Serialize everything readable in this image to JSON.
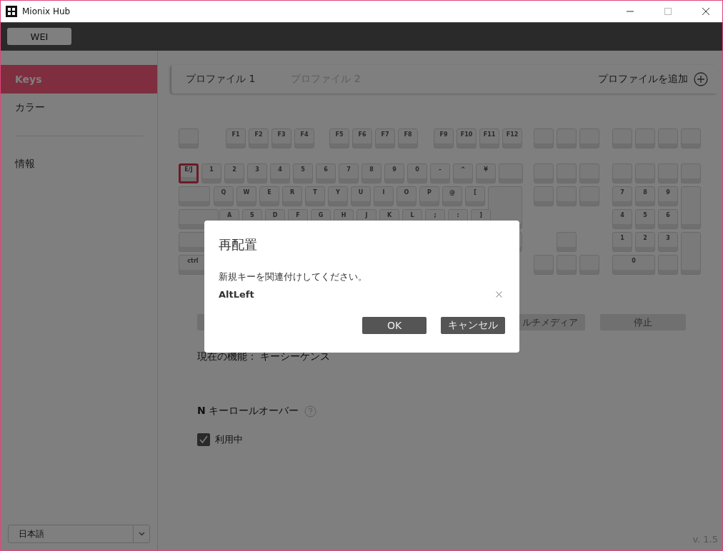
{
  "window": {
    "title": "Mionix Hub"
  },
  "device_tab": {
    "label": "WEI"
  },
  "sidebar": {
    "items": [
      {
        "label": "Keys",
        "selected": true
      },
      {
        "label": "カラー",
        "selected": false
      },
      {
        "label": "情報",
        "selected": false
      }
    ],
    "language": "日本語"
  },
  "profiles": [
    {
      "label": "プロファイル 1",
      "selected": true
    },
    {
      "label": "プロファイル 2",
      "selected": false
    }
  ],
  "add_profile": "プロファイルを追加",
  "keyboard": {
    "keys": [
      {
        "label": "F1",
        "selected": false
      },
      {
        "label": "F2",
        "selected": false
      },
      {
        "label": "F3",
        "selected": false
      },
      {
        "label": "F4",
        "selected": false
      },
      {
        "label": "F5",
        "selected": false
      },
      {
        "label": "F6",
        "selected": false
      },
      {
        "label": "F7",
        "selected": false
      },
      {
        "label": "F8",
        "selected": false
      },
      {
        "label": "F9",
        "selected": false
      },
      {
        "label": "F10",
        "selected": false
      },
      {
        "label": "F11",
        "selected": false
      },
      {
        "label": "F12",
        "selected": false
      },
      {
        "label": "E/J",
        "selected": true
      },
      {
        "label": "1",
        "selected": false
      },
      {
        "label": "2",
        "selected": false
      },
      {
        "label": "3",
        "selected": false
      },
      {
        "label": "4",
        "selected": false
      },
      {
        "label": "5",
        "selected": false
      },
      {
        "label": "6",
        "selected": false
      },
      {
        "label": "7",
        "selected": false
      },
      {
        "label": "8",
        "selected": false
      },
      {
        "label": "9",
        "selected": false
      },
      {
        "label": "0",
        "selected": false
      },
      {
        "label": "-",
        "selected": false
      },
      {
        "label": "^",
        "selected": false
      },
      {
        "label": "¥",
        "selected": false
      },
      {
        "label": "Q",
        "selected": false
      },
      {
        "label": "W",
        "selected": false
      },
      {
        "label": "E",
        "selected": false
      },
      {
        "label": "R",
        "selected": false
      },
      {
        "label": "T",
        "selected": false
      },
      {
        "label": "Y",
        "selected": false
      },
      {
        "label": "U",
        "selected": false
      },
      {
        "label": "I",
        "selected": false
      },
      {
        "label": "O",
        "selected": false
      },
      {
        "label": "P",
        "selected": false
      },
      {
        "label": "@",
        "selected": false
      },
      {
        "label": "[",
        "selected": false
      },
      {
        "label": "7",
        "selected": false
      },
      {
        "label": "8",
        "selected": false
      },
      {
        "label": "9",
        "selected": false
      },
      {
        "label": "A",
        "selected": false
      },
      {
        "label": "S",
        "selected": false
      },
      {
        "label": "D",
        "selected": false
      },
      {
        "label": "F",
        "selected": false
      },
      {
        "label": "G",
        "selected": false
      },
      {
        "label": "H",
        "selected": false
      },
      {
        "label": "J",
        "selected": false
      },
      {
        "label": "K",
        "selected": false
      },
      {
        "label": "L",
        "selected": false
      },
      {
        "label": ";",
        "selected": false
      },
      {
        "label": ":",
        "selected": false
      },
      {
        "label": "]",
        "selected": false
      },
      {
        "label": "4",
        "selected": false
      },
      {
        "label": "5",
        "selected": false
      },
      {
        "label": "6",
        "selected": false
      },
      {
        "label": "1",
        "selected": false
      },
      {
        "label": "2",
        "selected": false
      },
      {
        "label": "3",
        "selected": false
      },
      {
        "label": "ctrl",
        "selected": false
      },
      {
        "label": "0",
        "selected": false
      }
    ]
  },
  "function_buttons": [
    {
      "label": "ルチメディア"
    },
    {
      "label": "停止"
    }
  ],
  "current_function": "現在の機能： キーシーケンス",
  "nkro": {
    "title": "**N** キーロールオーバー",
    "checkbox": {
      "label": "利用中",
      "checked": true
    }
  },
  "version": "v. 1.5",
  "dialog": {
    "title": "再配置",
    "message": "新規キーを関連付けしてください。",
    "key": "AltLeft",
    "buttons": [
      "OK",
      "キャンセル"
    ]
  }
}
